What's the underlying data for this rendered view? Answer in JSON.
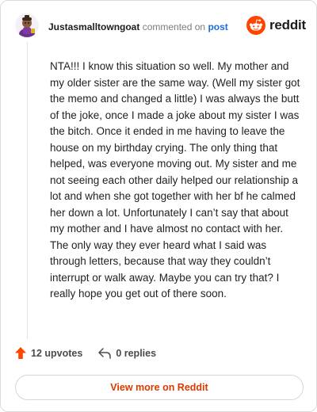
{
  "header": {
    "username": "Justasmalltowngoat",
    "action_text": "commented on",
    "post_link": "post",
    "brand_name": "reddit"
  },
  "comment": {
    "body": "NTA!!! I know this situation so well. My mother and my older sister are the same way. (Well my sister got the memo and changed a little) I was always the butt of the joke, once I made a joke about my sister I was the bitch. Once it ended in me having to leave the house on my birthday crying. The only thing that helped, was everyone moving out. My sister and me not seeing each other daily helped our relationship a lot and when she got together with her bf he calmed her down a lot. Unfortunately I can’t say that about my mother and I have almost no contact with her. The only way they ever heard what I said was through letters, because that way they couldn’t interrupt or walk away. Maybe you can try that? I really hope you get out of there soon."
  },
  "actions": {
    "upvotes_label": "12 upvotes",
    "replies_label": "0 replies"
  },
  "footer": {
    "view_more_label": "View more on Reddit"
  },
  "icons": {
    "avatar": "goat-avatar-icon",
    "brand": "reddit-snoo-icon",
    "upvote": "upvote-arrow-icon",
    "reply": "reply-arrow-icon"
  },
  "colors": {
    "brand_orange": "#ff4500",
    "link_blue": "#1a6ed8",
    "view_more_text": "#d93a00",
    "username": "#1c1c1c",
    "muted": "#7c7c7c"
  }
}
